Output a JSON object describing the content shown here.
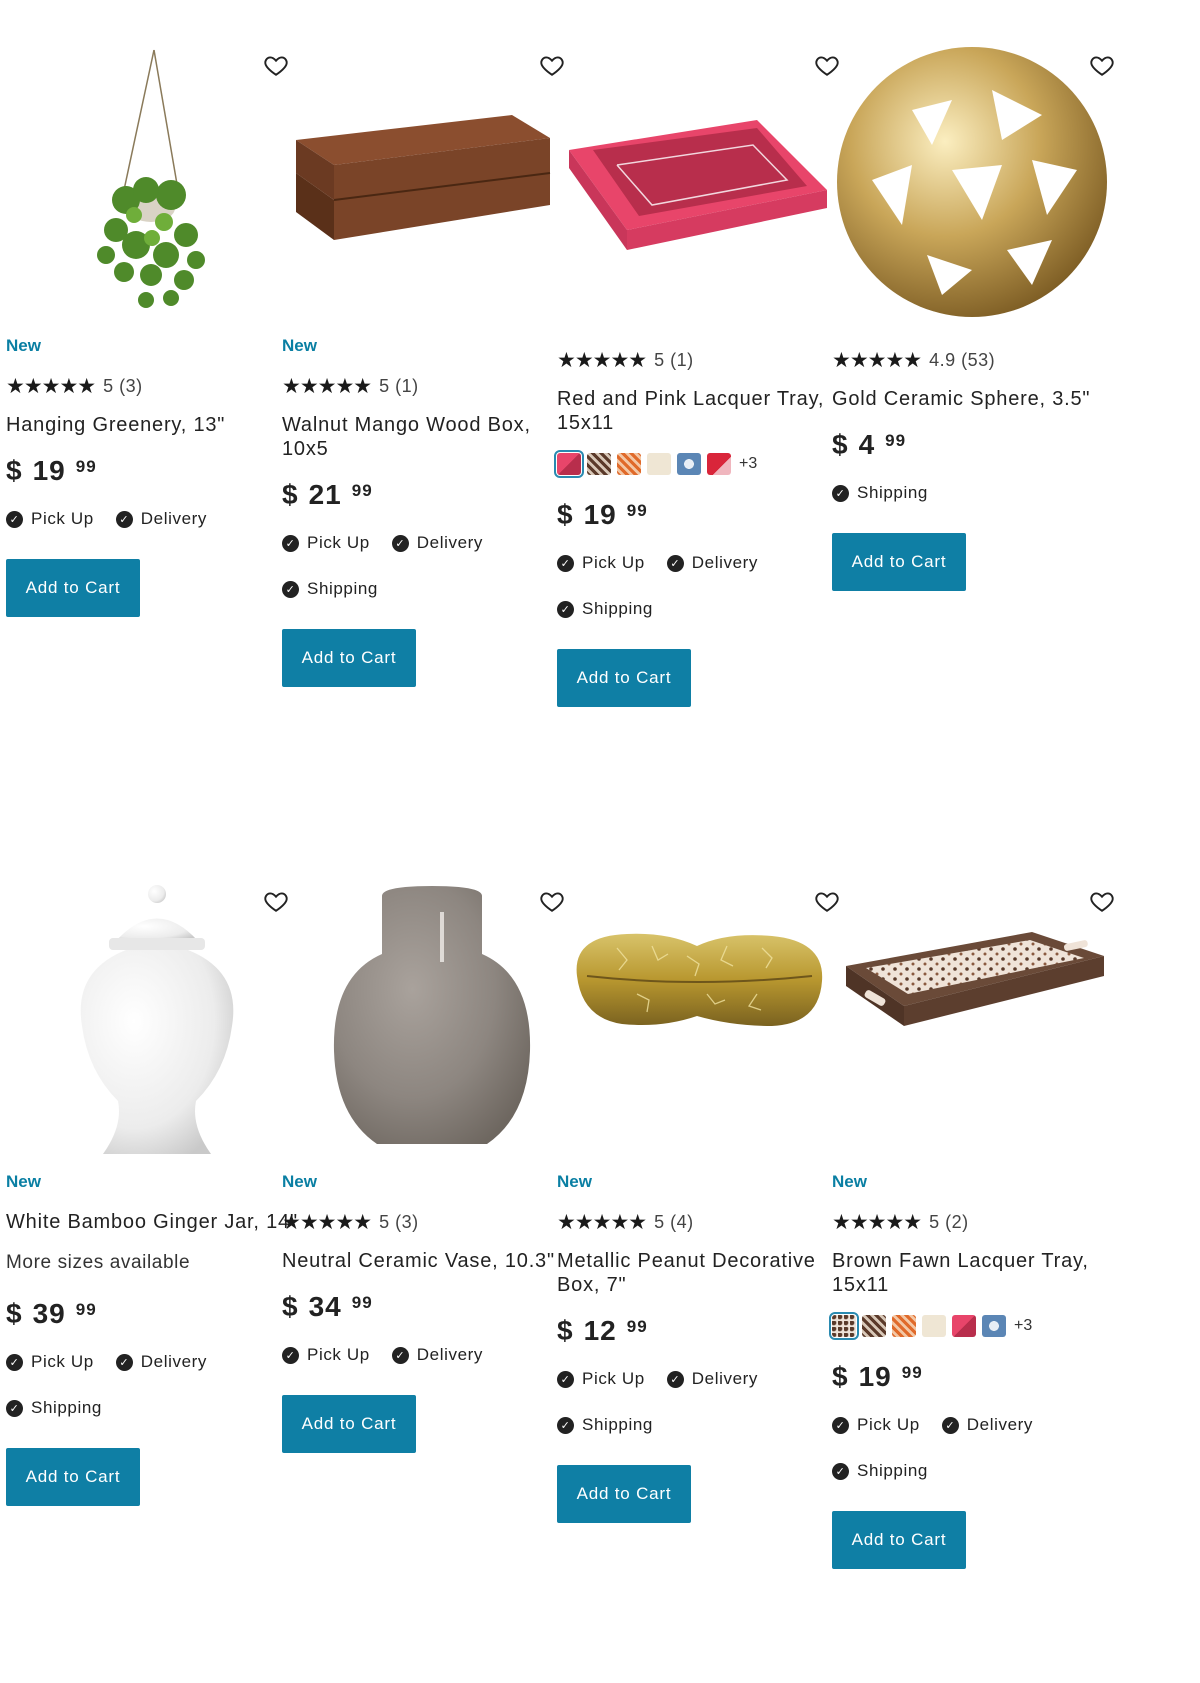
{
  "colors": {
    "accent": "#0f7fa5",
    "badge": "#0a7fa3"
  },
  "products": [
    {
      "badge": "New",
      "stars": "★★★★★",
      "rating": "5 (3)",
      "name": "Hanging Greenery, 13\"",
      "price_currency": "$",
      "price_dollars": "19",
      "price_cents": "99",
      "fulfillment": [
        "Pick Up",
        "Delivery"
      ],
      "button": "Add to Cart",
      "icon": "hanging-plant"
    },
    {
      "badge": "New",
      "stars": "★★★★★",
      "rating": "5 (1)",
      "name": "Walnut Mango Wood Box, 10x5",
      "price_currency": "$",
      "price_dollars": "21",
      "price_cents": "99",
      "fulfillment": [
        "Pick Up",
        "Delivery",
        "Shipping"
      ],
      "button": "Add to Cart",
      "icon": "wood-box"
    },
    {
      "badge": "",
      "stars": "★★★★★",
      "rating": "5 (1)",
      "name": "Red and Pink Lacquer Tray, 15x11",
      "swatch_more": "+3",
      "price_currency": "$",
      "price_dollars": "19",
      "price_cents": "99",
      "fulfillment": [
        "Pick Up",
        "Delivery",
        "Shipping"
      ],
      "button": "Add to Cart",
      "icon": "pink-tray"
    },
    {
      "badge": "",
      "stars": "★★★★★",
      "rating": "4.9 (53)",
      "name": "Gold Ceramic Sphere, 3.5\"",
      "price_currency": "$",
      "price_dollars": "4",
      "price_cents": "99",
      "fulfillment": [
        "Shipping"
      ],
      "button": "Add to Cart",
      "icon": "gold-sphere"
    },
    {
      "badge": "New",
      "stars": "",
      "rating": "",
      "name": "White Bamboo Ginger Jar, 14\"",
      "sizes": "More sizes available",
      "price_currency": "$",
      "price_dollars": "39",
      "price_cents": "99",
      "fulfillment": [
        "Pick Up",
        "Delivery",
        "Shipping"
      ],
      "button": "Add to Cart",
      "icon": "ginger-jar"
    },
    {
      "badge": "New",
      "stars": "★★★★★",
      "rating": "5 (3)",
      "name": "Neutral Ceramic Vase, 10.3\"",
      "price_currency": "$",
      "price_dollars": "34",
      "price_cents": "99",
      "fulfillment": [
        "Pick Up",
        "Delivery"
      ],
      "button": "Add to Cart",
      "icon": "ceramic-vase"
    },
    {
      "badge": "New",
      "stars": "★★★★★",
      "rating": "5 (4)",
      "name": "Metallic Peanut Decorative Box, 7\"",
      "price_currency": "$",
      "price_dollars": "12",
      "price_cents": "99",
      "fulfillment": [
        "Pick Up",
        "Delivery",
        "Shipping"
      ],
      "button": "Add to Cart",
      "icon": "peanut-box"
    },
    {
      "badge": "New",
      "stars": "★★★★★",
      "rating": "5 (2)",
      "name": "Brown Fawn Lacquer Tray, 15x11",
      "swatch_more": "+3",
      "price_currency": "$",
      "price_dollars": "19",
      "price_cents": "99",
      "fulfillment": [
        "Pick Up",
        "Delivery",
        "Shipping"
      ],
      "button": "Add to Cart",
      "icon": "brown-tray"
    }
  ]
}
